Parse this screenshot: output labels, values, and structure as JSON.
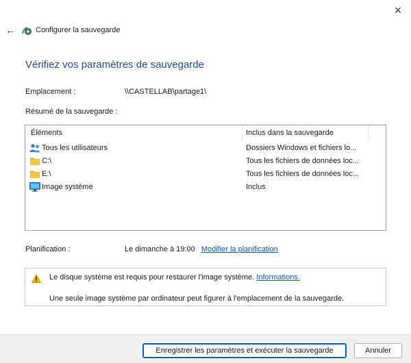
{
  "window": {
    "title": "Configurer la sauvegarde",
    "close_label": "×",
    "back_label": "←"
  },
  "heading": "Vérifiez vos paramètres de sauvegarde",
  "location": {
    "label": "Emplacement :",
    "value": "\\\\CASTELLAB\\partage1\\"
  },
  "summary": {
    "label": "Résumé de la sauvegarde :",
    "columns": [
      "Éléments",
      "Inclus dans la sauvegarde"
    ],
    "rows": [
      {
        "icon": "users-icon",
        "item": "Tous les utilisateurs",
        "included": "Dossiers Windows et fichiers lo..."
      },
      {
        "icon": "folder-icon",
        "item": "C:\\",
        "included": "Tous les fichiers de données loc..."
      },
      {
        "icon": "folder-icon",
        "item": "E:\\",
        "included": "Tous les fichiers de données loc..."
      },
      {
        "icon": "monitor-icon",
        "item": "Image système",
        "included": "Inclus"
      }
    ]
  },
  "schedule": {
    "label": "Planification :",
    "value": "Le dimanche à 19:00",
    "link": "Modifier la planification"
  },
  "warning": {
    "line1": "Le disque système est requis pour restaurer l'image système.",
    "line1_link": "Informations.",
    "line2": "Une seule image système par ordinateur peut figurer à l'emplacement de la sauvegarde."
  },
  "buttons": {
    "save": "Enregistrer les paramètres et exécuter la sauvegarde",
    "cancel": "Annuler"
  },
  "colors": {
    "heading": "#1f4e9e",
    "link": "#0a57c2",
    "primary_border": "#0a64d6",
    "footer_bg": "#f0f0f0",
    "folder": "#f4c542",
    "warning": "#f2b705"
  }
}
